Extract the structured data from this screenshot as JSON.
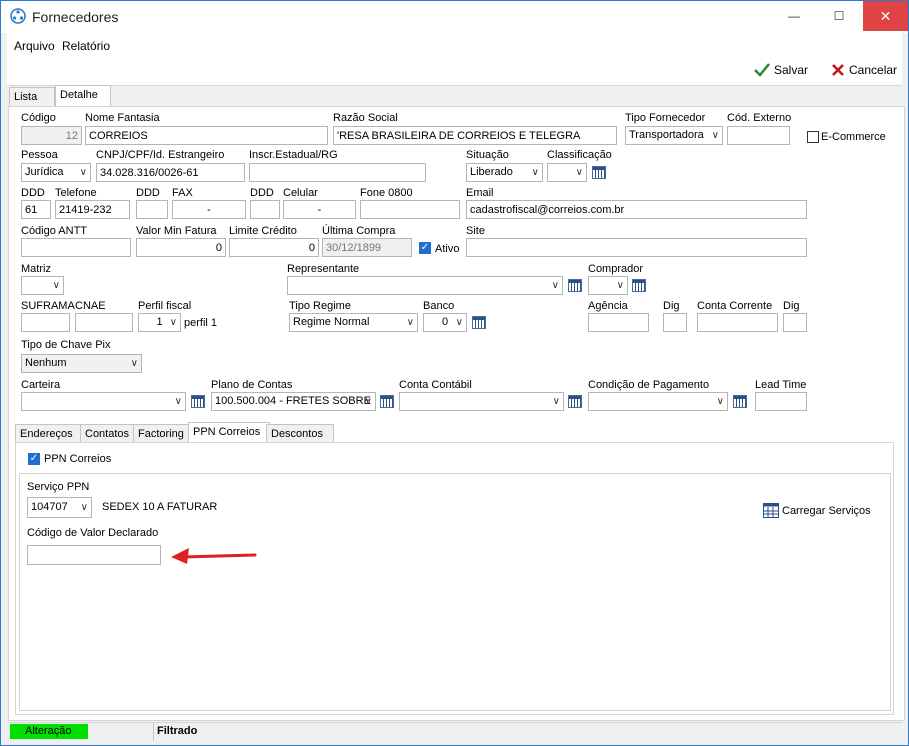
{
  "window": {
    "title": "Fornecedores",
    "minimize": "—",
    "maximize": "☐",
    "close": "✕"
  },
  "menu": {
    "arquivo": "Arquivo",
    "relatorio": "Relatório"
  },
  "toolbar": {
    "salvar": "Salvar",
    "cancelar": "Cancelar"
  },
  "tabs": {
    "lista": "Lista",
    "detalhe": "Detalhe"
  },
  "labels": {
    "codigo": "Código",
    "nome_fantasia": "Nome Fantasia",
    "razao_social": "Razão Social",
    "tipo_fornecedor": "Tipo Fornecedor",
    "cod_externo": "Cód. Externo",
    "ecommerce": "E-Commerce",
    "pessoa": "Pessoa",
    "cnpj": "CNPJ/CPF/Id. Estrangeiro",
    "inscr": "Inscr.Estadual/RG",
    "situacao": "Situação",
    "classificacao": "Classificação",
    "ddd1": "DDD",
    "telefone": "Telefone",
    "ddd2": "DDD",
    "fax": "FAX",
    "ddd3": "DDD",
    "celular": "Celular",
    "fone0800": "Fone 0800",
    "email": "Email",
    "codigo_antt": "Código ANTT",
    "valor_min": "Valor Min Fatura",
    "limite": "Limite Crédito",
    "ultima_compra": "Última Compra",
    "ativo": "Ativo",
    "site": "Site",
    "matriz": "Matriz",
    "representante": "Representante",
    "comprador": "Comprador",
    "suframa": "SUFRAMA",
    "cnae": "CNAE",
    "perfil_fiscal": "Perfil fiscal",
    "perfil_suffix": "perfil 1",
    "tipo_regime": "Tipo Regime",
    "banco": "Banco",
    "agencia": "Agência",
    "dig1": "Dig",
    "conta_corrente": "Conta Corrente",
    "dig2": "Dig",
    "tipo_chave_pix": "Tipo de Chave Pix",
    "carteira": "Carteira",
    "plano_contas": "Plano de Contas",
    "conta_contabil": "Conta Contábil",
    "cond_pagamento": "Condição de Pagamento",
    "lead_time": "Lead Time"
  },
  "values": {
    "codigo": "12",
    "nome_fantasia": "CORREIOS",
    "razao_social": "'RESA BRASILEIRA DE CORREIOS E TELEGRA",
    "tipo_fornecedor": "Transportadora",
    "pessoa": "Jurídica",
    "cnpj": "34.028.316/0026-61",
    "situacao": "Liberado",
    "ddd1": "61",
    "telefone": "21419-232",
    "fax": "-",
    "celular": "-",
    "email": "cadastrofiscal@correios.com.br",
    "valor_min": "0",
    "limite": "0",
    "ultima_compra": "30/12/1899",
    "perfil_fiscal": "1",
    "tipo_regime": "Regime Normal",
    "banco": "0",
    "tipo_chave_pix": "Nenhum",
    "plano_contas": "100.500.004 - FRETES SOBRE"
  },
  "subtabs": {
    "enderecos": "Endereços",
    "contatos": "Contatos",
    "factoring": "Factoring",
    "ppn": "PPN Correios",
    "descontos": "Descontos"
  },
  "ppn": {
    "checkbox_label": "PPN Correios",
    "servico_label": "Serviço PPN",
    "servico_code": "104707",
    "servico_desc": "SEDEX 10 A FATURAR",
    "carregar": "Carregar Serviços",
    "valor_declarado_label": "Código de Valor Declarado",
    "valor_declarado": ""
  },
  "status": {
    "mode": "Alteração",
    "filter": "Filtrado"
  },
  "colors": {
    "accent": "#2b79c7",
    "status_green": "#00e000",
    "close_red": "#e04343",
    "arrow_red": "#e02020"
  }
}
